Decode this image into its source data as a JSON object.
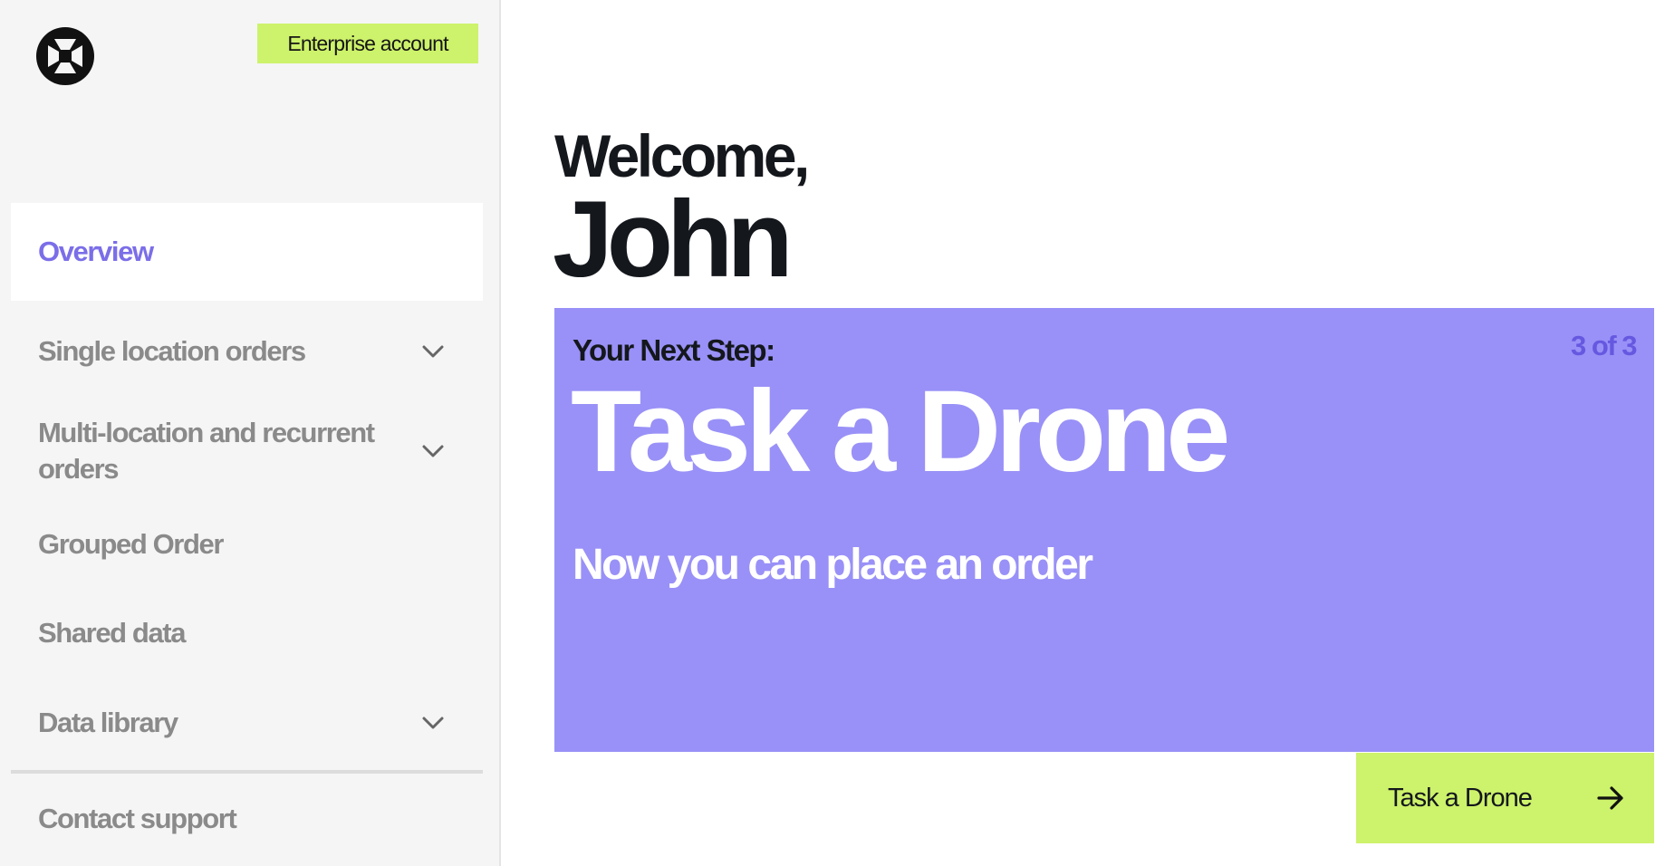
{
  "app": {
    "accent": "#7b6ee8",
    "highlight": "#cdf26b",
    "card_color": "#9991f7"
  },
  "sidebar": {
    "logo_icon": "brand-logo-icon",
    "account_badge": "Enterprise account",
    "items": [
      {
        "label": "Overview",
        "active": true
      },
      {
        "label": "Single location orders",
        "icon": "chevron-down-icon"
      },
      {
        "label": "Multi-location and recurrent orders",
        "icon": "chevron-down-icon"
      },
      {
        "label": "Grouped Order"
      },
      {
        "label": "Shared data"
      },
      {
        "label": "Data library",
        "icon": "chevron-down-icon"
      }
    ],
    "footer_item": {
      "label": "Contact support"
    }
  },
  "main": {
    "greeting": "Welcome,",
    "user_name": "John",
    "card": {
      "heading": "Your Next Step:",
      "step": "3 of 3",
      "title": "Task a Drone",
      "subtitle": "Now you can place an order"
    },
    "cta": {
      "label": "Task a Drone",
      "icon": "arrow-right-icon"
    }
  }
}
